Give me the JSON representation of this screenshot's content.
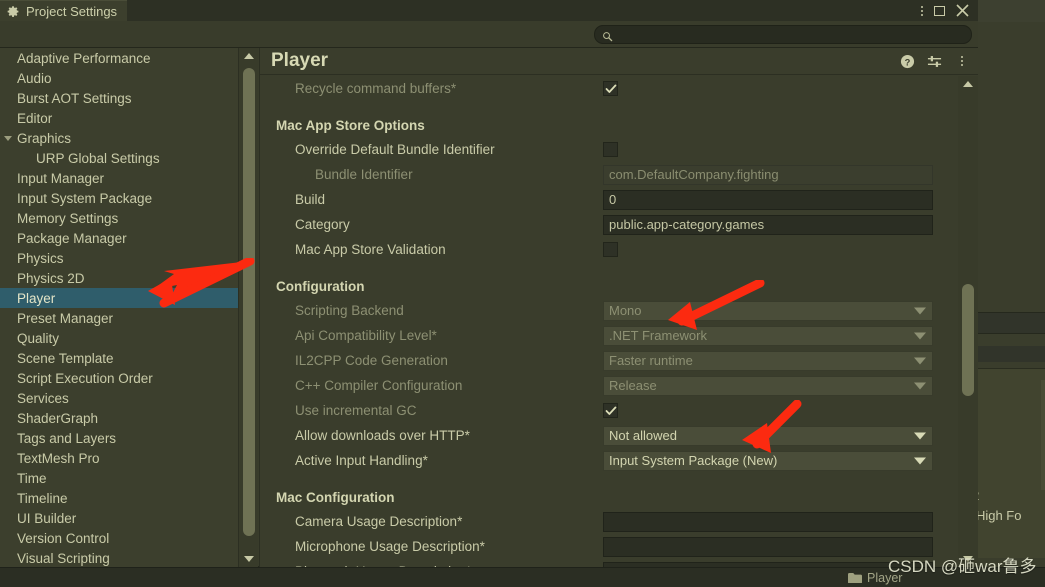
{
  "window": {
    "tab_label": "Project Settings",
    "tab_icon": "gear-icon",
    "controls": [
      "kebab-menu-icon",
      "maximize-icon",
      "close-icon"
    ]
  },
  "search": {
    "value": "",
    "placeholder": "",
    "icon": "search-icon"
  },
  "sidebar": {
    "items": [
      {
        "label": "Adaptive Performance",
        "indent": false,
        "selected": false,
        "foldout": false
      },
      {
        "label": "Audio",
        "indent": false,
        "selected": false,
        "foldout": false
      },
      {
        "label": "Burst AOT Settings",
        "indent": false,
        "selected": false,
        "foldout": false
      },
      {
        "label": "Editor",
        "indent": false,
        "selected": false,
        "foldout": false
      },
      {
        "label": "Graphics",
        "indent": false,
        "selected": false,
        "foldout": true
      },
      {
        "label": "URP Global Settings",
        "indent": true,
        "selected": false,
        "foldout": false
      },
      {
        "label": "Input Manager",
        "indent": false,
        "selected": false,
        "foldout": false
      },
      {
        "label": "Input System Package",
        "indent": false,
        "selected": false,
        "foldout": false
      },
      {
        "label": "Memory Settings",
        "indent": false,
        "selected": false,
        "foldout": false
      },
      {
        "label": "Package Manager",
        "indent": false,
        "selected": false,
        "foldout": false
      },
      {
        "label": "Physics",
        "indent": false,
        "selected": false,
        "foldout": false
      },
      {
        "label": "Physics 2D",
        "indent": false,
        "selected": false,
        "foldout": false
      },
      {
        "label": "Player",
        "indent": false,
        "selected": true,
        "foldout": false
      },
      {
        "label": "Preset Manager",
        "indent": false,
        "selected": false,
        "foldout": false
      },
      {
        "label": "Quality",
        "indent": false,
        "selected": false,
        "foldout": false
      },
      {
        "label": "Scene Template",
        "indent": false,
        "selected": false,
        "foldout": false
      },
      {
        "label": "Script Execution Order",
        "indent": false,
        "selected": false,
        "foldout": false
      },
      {
        "label": "Services",
        "indent": false,
        "selected": false,
        "foldout": false
      },
      {
        "label": "ShaderGraph",
        "indent": false,
        "selected": false,
        "foldout": false
      },
      {
        "label": "Tags and Layers",
        "indent": false,
        "selected": false,
        "foldout": false
      },
      {
        "label": "TextMesh Pro",
        "indent": false,
        "selected": false,
        "foldout": false
      },
      {
        "label": "Time",
        "indent": false,
        "selected": false,
        "foldout": false
      },
      {
        "label": "Timeline",
        "indent": false,
        "selected": false,
        "foldout": false
      },
      {
        "label": "UI Builder",
        "indent": false,
        "selected": false,
        "foldout": false
      },
      {
        "label": "Version Control",
        "indent": false,
        "selected": false,
        "foldout": false
      },
      {
        "label": "Visual Scripting",
        "indent": false,
        "selected": false,
        "foldout": false
      }
    ]
  },
  "panel": {
    "title": "Player",
    "icons": [
      "help-icon",
      "preset-icon",
      "kebab-menu-icon"
    ],
    "rows": [
      {
        "kind": "field",
        "label": "Recycle command buffers*",
        "dim": true,
        "sub": false,
        "control": "checkbox",
        "checked": true
      },
      {
        "kind": "spacer"
      },
      {
        "kind": "section",
        "label": "Mac App Store Options"
      },
      {
        "kind": "field",
        "label": "Override Default Bundle Identifier",
        "dim": false,
        "sub": false,
        "control": "checkbox",
        "checked": false
      },
      {
        "kind": "field",
        "label": "Bundle Identifier",
        "dim": true,
        "sub": true,
        "control": "text",
        "value": "com.DefaultCompany.fighting",
        "disabled": true
      },
      {
        "kind": "field",
        "label": "Build",
        "dim": false,
        "sub": false,
        "control": "text",
        "value": "0",
        "disabled": false
      },
      {
        "kind": "field",
        "label": "Category",
        "dim": false,
        "sub": false,
        "control": "text",
        "value": "public.app-category.games",
        "disabled": false
      },
      {
        "kind": "field",
        "label": "Mac App Store Validation",
        "dim": false,
        "sub": false,
        "control": "checkbox",
        "checked": false
      },
      {
        "kind": "spacer"
      },
      {
        "kind": "section",
        "label": "Configuration"
      },
      {
        "kind": "field",
        "label": "Scripting Backend",
        "dim": true,
        "sub": false,
        "control": "dropdown",
        "value": "Mono",
        "disabled": true
      },
      {
        "kind": "field",
        "label": "Api Compatibility Level*",
        "dim": true,
        "sub": false,
        "control": "dropdown",
        "value": ".NET Framework",
        "disabled": true
      },
      {
        "kind": "field",
        "label": "IL2CPP Code Generation",
        "dim": true,
        "sub": false,
        "control": "dropdown",
        "value": "Faster runtime",
        "disabled": true
      },
      {
        "kind": "field",
        "label": "C++ Compiler Configuration",
        "dim": true,
        "sub": false,
        "control": "dropdown",
        "value": "Release",
        "disabled": true
      },
      {
        "kind": "field",
        "label": "Use incremental GC",
        "dim": true,
        "sub": false,
        "control": "checkbox",
        "checked": true
      },
      {
        "kind": "field",
        "label": "Allow downloads over HTTP*",
        "dim": false,
        "sub": false,
        "control": "dropdown",
        "value": "Not allowed",
        "disabled": false
      },
      {
        "kind": "field",
        "label": "Active Input Handling*",
        "dim": false,
        "sub": false,
        "control": "dropdown",
        "value": "Input System Package (New)",
        "disabled": false
      },
      {
        "kind": "spacer"
      },
      {
        "kind": "section",
        "label": "Mac Configuration"
      },
      {
        "kind": "field",
        "label": "Camera Usage Description*",
        "dim": false,
        "sub": false,
        "control": "text",
        "value": "",
        "disabled": false
      },
      {
        "kind": "field",
        "label": "Microphone Usage Description*",
        "dim": false,
        "sub": false,
        "control": "text",
        "value": "",
        "disabled": false
      },
      {
        "kind": "field",
        "label": "Bluetooth Usage Description*",
        "dim": false,
        "sub": false,
        "control": "text",
        "value": "",
        "disabled": false
      }
    ]
  },
  "background": {
    "line_1": "2",
    "line_2": "- High Fo"
  },
  "statusbar": {
    "label": "Player",
    "icon": "folder-icon"
  },
  "watermark": {
    "text": "CSDN @砸war鲁多"
  },
  "annotations": {
    "arrows": [
      {
        "name": "arrow-to-player-sidebar-item",
        "color": "#fc2a10"
      },
      {
        "name": "arrow-to-api-compatibility-level",
        "color": "#fc2a10"
      },
      {
        "name": "arrow-to-active-input-handling",
        "color": "#fc2a10"
      }
    ]
  },
  "colors": {
    "selection": "#2f5d6b",
    "panel_bg": "#3a3d2c",
    "sidebar_bg": "#3c3f2d",
    "text": "#c9cba8",
    "annotation": "#fc2a10"
  }
}
